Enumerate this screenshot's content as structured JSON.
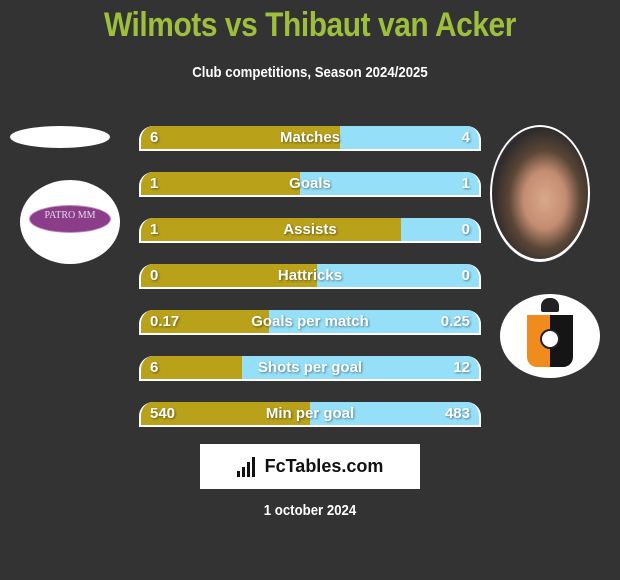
{
  "header": {
    "title": "Wilmots vs Thibaut van Acker",
    "subtitle": "Club competitions, Season 2024/2025"
  },
  "colors": {
    "background": "#333333",
    "title": "#9dbf3c",
    "left_bar": "#b9a11a",
    "right_bar": "#95e0f8"
  },
  "left_player": {
    "name": "Wilmots",
    "club_logo_icon": "patro-eisden-maasmechelen-logo",
    "club_logo_text": "PATRO MM"
  },
  "right_player": {
    "name": "Thibaut van Acker",
    "photo": "player-photo",
    "club_logo_icon": "club-crest-orange-black-shield"
  },
  "stats": [
    {
      "label": "Matches",
      "left": "6",
      "right": "4",
      "left_share": 0.59
    },
    {
      "label": "Goals",
      "left": "1",
      "right": "1",
      "left_share": 0.47
    },
    {
      "label": "Assists",
      "left": "1",
      "right": "0",
      "left_share": 0.77
    },
    {
      "label": "Hattricks",
      "left": "0",
      "right": "0",
      "left_share": 0.52
    },
    {
      "label": "Goals per match",
      "left": "0.17",
      "right": "0.25",
      "left_share": 0.38
    },
    {
      "label": "Shots per goal",
      "left": "6",
      "right": "12",
      "left_share": 0.3
    },
    {
      "label": "Min per goal",
      "left": "540",
      "right": "483",
      "left_share": 0.5
    }
  ],
  "brand": {
    "icon": "bar-chart-growth-icon",
    "text": "FcTables.com"
  },
  "footer": {
    "date": "1 october 2024"
  }
}
